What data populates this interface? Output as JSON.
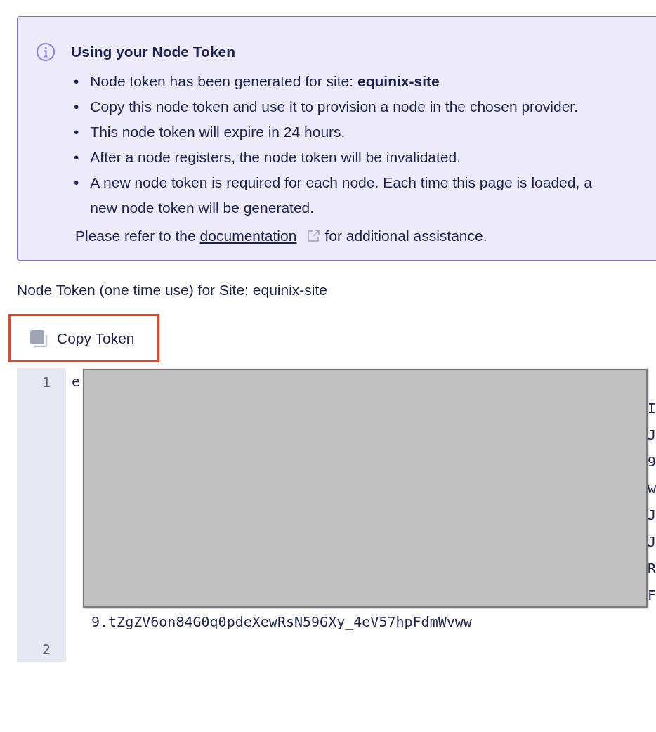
{
  "info": {
    "title": "Using your Node Token",
    "bullets": [
      {
        "marker": "•",
        "text": "Node token has been generated for site: **equinix-site**"
      },
      {
        "marker": "•",
        "text": "Copy this node token and use it to provision a node in the chosen provider."
      },
      {
        "marker": "•",
        "text": "This node token will expire in 24 hours."
      },
      {
        "marker": "•",
        "text": "After a node registers, the node token will be invalidated."
      },
      {
        "marker": "•",
        "text": "A new node token is required for each node. Each time this page is loaded, a new node token will be generated."
      }
    ],
    "footer": {
      "before": "Please refer to the",
      "link": "documentation",
      "after": "for additional assistance."
    }
  },
  "token_label": "Node Token (one time use) for Site: equinix-site",
  "copy_button": {
    "label": "Copy Token",
    "highlighted": true
  },
  "editor": {
    "lines": [
      {
        "number": "1",
        "rows": [
          {
            "kind": "start",
            "text": "e"
          },
          {
            "kind": "edge",
            "text": "I"
          },
          {
            "kind": "edge",
            "text": "J"
          },
          {
            "kind": "edge",
            "text": "9"
          },
          {
            "kind": "edge",
            "text": "w"
          },
          {
            "kind": "edge",
            "text": "J"
          },
          {
            "kind": "edge",
            "text": "J"
          },
          {
            "kind": "edge",
            "text": "R"
          },
          {
            "kind": "edge",
            "text": "F"
          },
          {
            "kind": "wrap",
            "text": "9.tZgZV6on84G0q0pdeXewRsN59GXy_4eV57hpFdmWvww"
          }
        ]
      },
      {
        "number": "2"
      }
    ]
  }
}
